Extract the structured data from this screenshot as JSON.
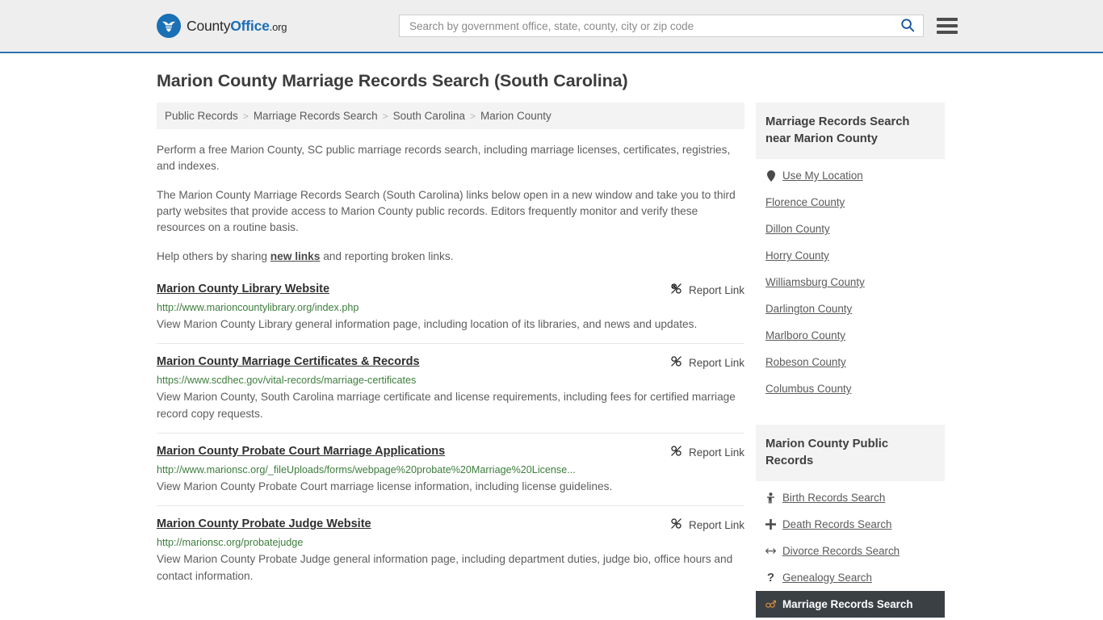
{
  "header": {
    "logo": {
      "part1": "County",
      "part2": "Office",
      "part3": ".org",
      "icon": "eagle-shield-logo-icon"
    },
    "search": {
      "placeholder": "Search by government office, state, county, city or zip code",
      "value": "",
      "search_icon": "search-icon"
    },
    "menu_icon": "hamburger-menu-icon",
    "accent_color": "#2c73b4",
    "background_color": "#eeeeee"
  },
  "page": {
    "title": "Marion County Marriage Records Search (South Carolina)"
  },
  "breadcrumb": {
    "separator": ">",
    "items": [
      {
        "label": "Public Records"
      },
      {
        "label": "Marriage Records Search"
      },
      {
        "label": "South Carolina"
      },
      {
        "label": "Marion County"
      }
    ]
  },
  "intro": {
    "p1": "Perform a free Marion County, SC public marriage records search, including marriage licenses, certificates, registries, and indexes.",
    "p2": "The Marion County Marriage Records Search (South Carolina) links below open in a new window and take you to third party websites that provide access to Marion County public records. Editors frequently monitor and verify these resources on a routine basis.",
    "p3_before": "Help others by sharing ",
    "p3_link": "new links",
    "p3_after": " and reporting broken links."
  },
  "results": {
    "report_label": "Report Link",
    "report_icon": "broken-link-icon",
    "items": [
      {
        "title": "Marion County Library Website",
        "url": "http://www.marioncountylibrary.org/index.php",
        "description": "View Marion County Library general information page, including location of its libraries, and news and updates."
      },
      {
        "title": "Marion County Marriage Certificates & Records",
        "url": "https://www.scdhec.gov/vital-records/marriage-certificates",
        "description": "View Marion County, South Carolina marriage certificate and license requirements, including fees for certified marriage record copy requests."
      },
      {
        "title": "Marion County Probate Court Marriage Applications",
        "url": "http://www.marionsc.org/_fileUploads/forms/webpage%20probate%20Marriage%20License...",
        "description": "View Marion County Probate Court marriage license information, including license guidelines."
      },
      {
        "title": "Marion County Probate Judge Website",
        "url": "http://marionsc.org/probatejudge",
        "description": "View Marion County Probate Judge general information page, including department duties, judge bio, office hours and contact information."
      }
    ]
  },
  "sidebar": {
    "nearby": {
      "heading": "Marriage Records Search near Marion County",
      "use_location": {
        "label": "Use My Location",
        "icon": "map-pin-icon"
      },
      "counties": [
        {
          "label": "Florence County"
        },
        {
          "label": "Dillon County"
        },
        {
          "label": "Horry County"
        },
        {
          "label": "Williamsburg County"
        },
        {
          "label": "Darlington County"
        },
        {
          "label": "Marlboro County"
        },
        {
          "label": "Robeson County"
        },
        {
          "label": "Columbus County"
        }
      ]
    },
    "public_records": {
      "heading": "Marion County Public Records",
      "items": [
        {
          "label": "Birth Records Search",
          "icon": "baby-icon",
          "active": false
        },
        {
          "label": "Death Records Search",
          "icon": "cross-icon",
          "active": false
        },
        {
          "label": "Divorce Records Search",
          "icon": "double-arrow-icon",
          "active": false
        },
        {
          "label": "Genealogy Search",
          "icon": "question-mark-icon",
          "active": false
        },
        {
          "label": "Marriage Records Search",
          "icon": "male-female-icon",
          "active": true
        }
      ],
      "active_background": "#3b4045",
      "active_icon_color": "#d98f3a"
    }
  }
}
